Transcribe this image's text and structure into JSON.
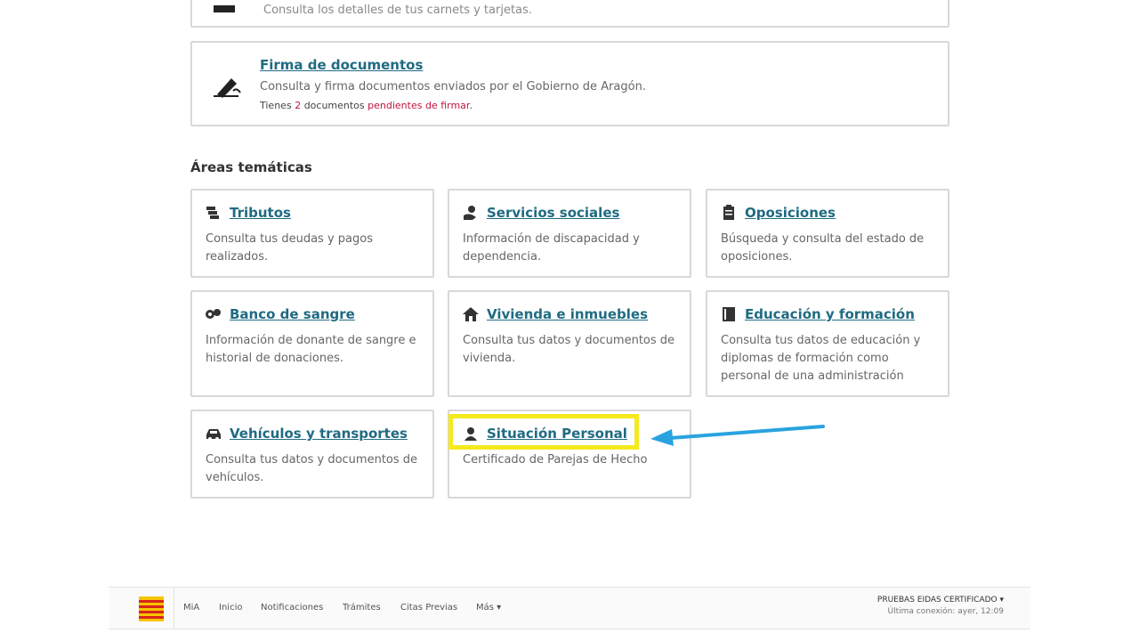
{
  "cards": {
    "carnets": {
      "desc": "Consulta los detalles de tus carnets y tarjetas."
    },
    "firma": {
      "title": "Firma de documentos",
      "desc": "Consulta y firma documentos enviados por el Gobierno de Aragón.",
      "note_prefix": "Tienes",
      "note_count": "2",
      "note_middle": "documentos",
      "note_pending": "pendientes de firmar",
      "note_end": "."
    }
  },
  "section_title": "Áreas temáticas",
  "tiles": [
    {
      "title": "Tributos",
      "desc": "Consulta tus deudas y pagos realizados.",
      "icon": "coins-icon"
    },
    {
      "title": "Servicios sociales",
      "desc": "Información de discapacidad y dependencia.",
      "icon": "care-hand-icon"
    },
    {
      "title": "Oposiciones",
      "desc": "Búsqueda y consulta del estado de oposiciones.",
      "icon": "clipboard-icon"
    },
    {
      "title": "Banco de sangre",
      "desc": "Información de donante de sangre e historial de donaciones.",
      "icon": "blood-drop-icon"
    },
    {
      "title": "Vivienda e inmuebles",
      "desc": "Consulta tus datos y documentos de vivienda.",
      "icon": "house-icon"
    },
    {
      "title": "Educación y formación",
      "desc": "Consulta tus datos de educación y diplomas de formación como personal de una administración",
      "icon": "book-icon"
    },
    {
      "title": "Vehículos y transportes",
      "desc": "Consulta tus datos y documentos de vehículos.",
      "icon": "car-icon"
    },
    {
      "title": "Situación Personal",
      "desc": "Certificado de Parejas de Hecho",
      "icon": "person-icon"
    }
  ],
  "footer": {
    "brand": "MiA",
    "nav": [
      "Inicio",
      "Notificaciones",
      "Trámites",
      "Citas Previas",
      "Más ▾"
    ],
    "user": "PRUEBAS EIDAS CERTIFICADO ▾",
    "last_connection": "Última conexión: ayer, 12:09"
  },
  "colors": {
    "link": "#1f6b82",
    "pending": "#c0143c",
    "highlight": "#f5ea1d",
    "arrow": "#29a3e0"
  }
}
